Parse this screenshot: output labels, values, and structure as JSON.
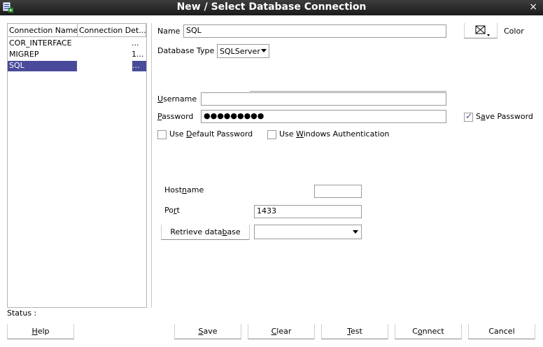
{
  "window": {
    "title": "New / Select Database Connection",
    "close_glyph": "×"
  },
  "list": {
    "headers": [
      "Connection Name",
      "Connection Det..."
    ],
    "rows": [
      {
        "name": "COR_INTERFACE",
        "detail": "..."
      },
      {
        "name": "MIGREP",
        "detail": "1..."
      },
      {
        "name": "SQL",
        "detail": "..."
      }
    ],
    "selected_index": 2
  },
  "form": {
    "name_label": "Name",
    "name_value": "SQL",
    "color_label": "Color",
    "db_type_label": "Database Type",
    "db_type_value": "SQLServer",
    "username_label": "Username",
    "username_value": "",
    "password_label": "Password",
    "password_value": "●●●●●●●●●",
    "save_password_label": "Save Password",
    "save_password_checked": true,
    "use_default_password_label": "Use Default Password",
    "use_windows_auth_label": "Use Windows Authentication",
    "hostname_label": "Hostname",
    "hostname_value": "",
    "port_label": "Port",
    "port_value": "1433",
    "retrieve_db_label": "Retrieve database",
    "database_value": ""
  },
  "status": {
    "label": "Status :"
  },
  "buttons": {
    "help": "Help",
    "save": "Save",
    "clear": "Clear",
    "test": "Test",
    "connect": "Connect",
    "cancel": "Cancel"
  },
  "colors": {
    "selection": "#4a4a9a",
    "titlebar": "#2a2a2a"
  },
  "icons": {
    "app": "database-connection-icon",
    "color_picker": "color-picker-icon"
  }
}
